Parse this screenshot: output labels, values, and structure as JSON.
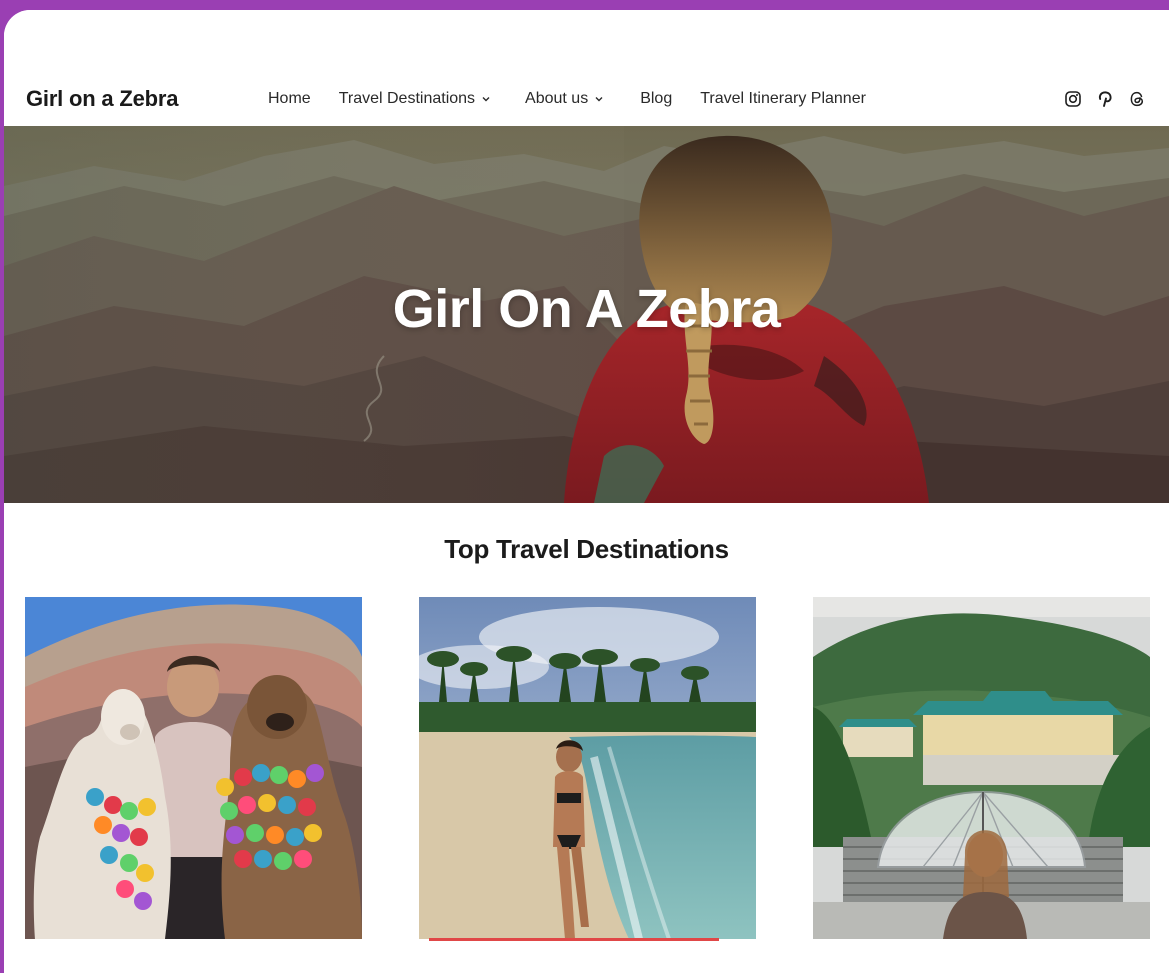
{
  "header": {
    "site_title": "Girl on a Zebra",
    "nav": [
      {
        "label": "Home",
        "has_dropdown": false
      },
      {
        "label": "Travel Destinations",
        "has_dropdown": true
      },
      {
        "label": "About us",
        "has_dropdown": true
      },
      {
        "label": "Blog",
        "has_dropdown": false
      },
      {
        "label": "Travel Itinerary Planner",
        "has_dropdown": false
      }
    ],
    "social_icons": [
      "instagram-icon",
      "pinterest-icon",
      "threads-icon"
    ]
  },
  "hero": {
    "title": "Girl On A Zebra",
    "image": "woman-with-braid-overlooking-mountains"
  },
  "section": {
    "title": "Top Travel Destinations",
    "cards": [
      {
        "image": "woman-with-alpacas-rainbow-mountain"
      },
      {
        "image": "woman-on-tropical-beach"
      },
      {
        "image": "woman-with-umbrella-at-palace"
      }
    ]
  },
  "colors": {
    "frame_background": "#9a3fb3",
    "page_background": "#ffffff",
    "text": "#1e1e1e",
    "hero_title": "#ffffff"
  }
}
